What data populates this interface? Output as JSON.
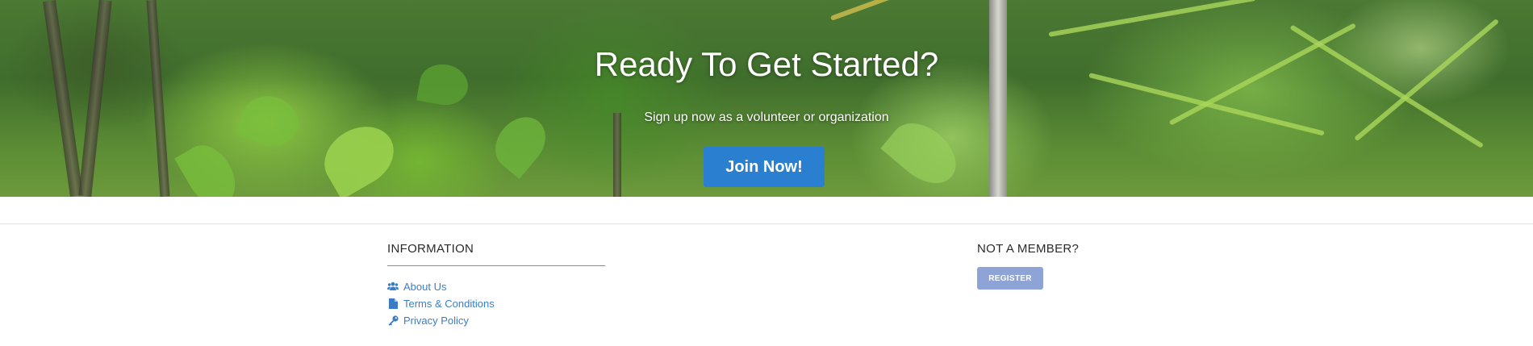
{
  "hero": {
    "title": "Ready To Get Started?",
    "subtitle": "Sign up now as a volunteer or organization",
    "join_label": "Join Now!"
  },
  "footer": {
    "information": {
      "heading": "INFORMATION",
      "links": [
        {
          "label": "About Us",
          "icon": "users-icon"
        },
        {
          "label": "Terms & Conditions",
          "icon": "document-icon"
        },
        {
          "label": "Privacy Policy",
          "icon": "key-icon"
        }
      ]
    },
    "membership": {
      "heading": "NOT A MEMBER?",
      "register_label": "REGISTER"
    }
  },
  "colors": {
    "primary_button": "#2a7fd0",
    "register_button": "#8ea4d6",
    "link": "#3b7dc4"
  }
}
